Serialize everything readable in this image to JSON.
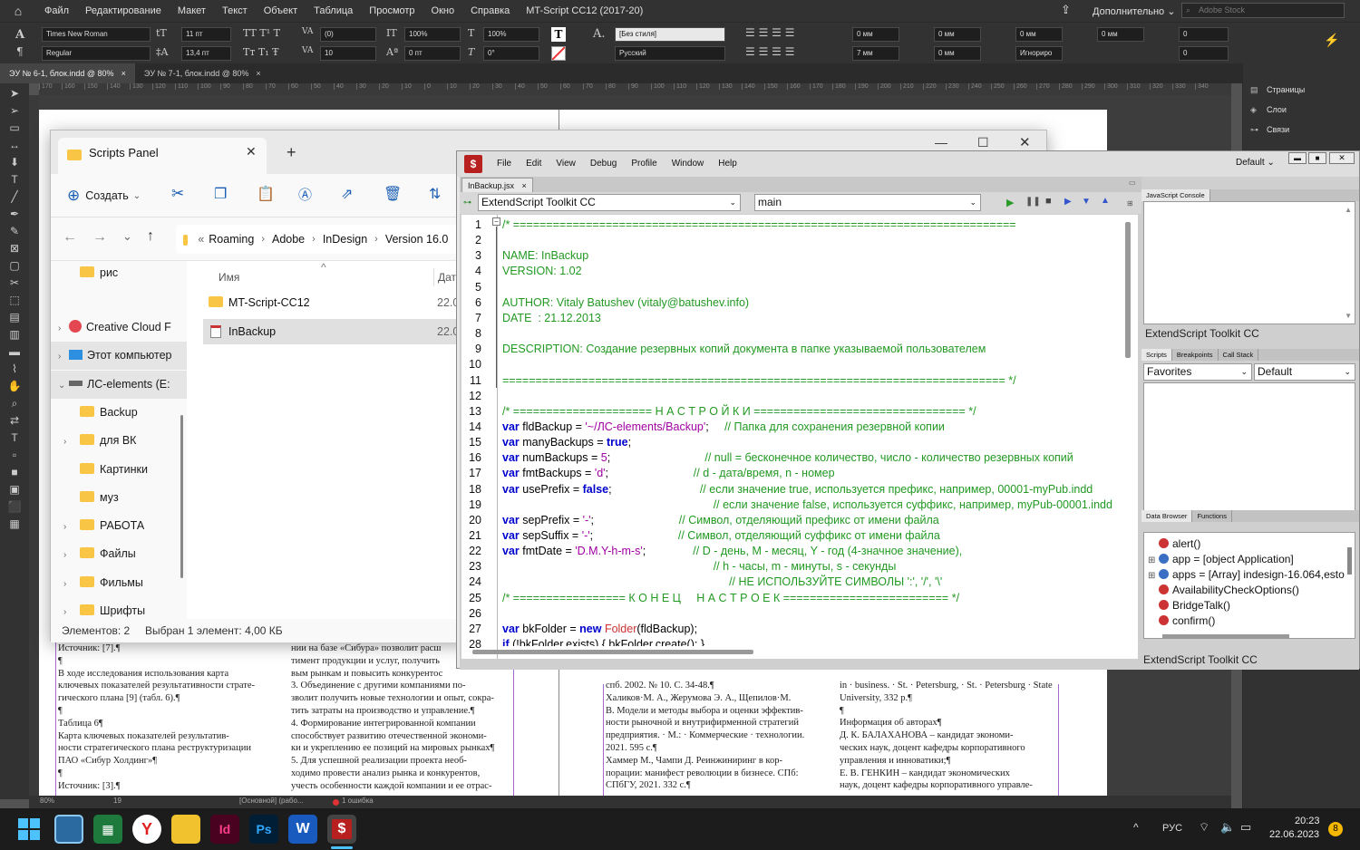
{
  "indesign": {
    "menu": [
      "Файл",
      "Редактирование",
      "Макет",
      "Текст",
      "Объект",
      "Таблица",
      "Просмотр",
      "Окно",
      "Справка",
      "MT-Script CC12 (2017-20)"
    ],
    "workspace": "Дополнительно",
    "stock_search_placeholder": "Adobe Stock",
    "control": {
      "font_family": "Times New Roman",
      "font_style": "Regular",
      "font_size": "11 пт",
      "leading": "13,4 пт",
      "kerning": "(0)",
      "tracking": "10",
      "vscale": "100%",
      "hscale": "100%",
      "baseline": "0 пт",
      "skew": "0°",
      "char_style": "[Без стиля]",
      "language": "Русский",
      "indent_left": "0 мм",
      "indent_first": "7 мм",
      "indent_right": "0 мм",
      "indent_last": "0 мм",
      "space_before": "0 мм",
      "space_after": "0 мм",
      "hyphenate": "Игнориро",
      "drop_lines": "0",
      "drop_chars": "0",
      "zero": "0"
    },
    "tabs": [
      {
        "label": "ЭУ № 6-1, блок.indd @ 80%",
        "active": true
      },
      {
        "label": "ЭУ № 7-1, блок.indd @ 80%",
        "active": false
      }
    ],
    "ruler_marks": [
      "170",
      "160",
      "150",
      "140",
      "130",
      "120",
      "110",
      "100",
      "90",
      "80",
      "70",
      "60",
      "50",
      "40",
      "30",
      "20",
      "10",
      "0",
      "10",
      "20",
      "30",
      "40",
      "50",
      "60",
      "70",
      "80",
      "90",
      "100",
      "110",
      "120",
      "130",
      "140",
      "150",
      "160",
      "170",
      "180",
      "190",
      "200",
      "210",
      "220",
      "230",
      "240",
      "250",
      "260",
      "270",
      "280",
      "290",
      "300",
      "310",
      "320",
      "330",
      "340"
    ],
    "right_panel": [
      {
        "icon": "pages-icon",
        "label": "Страницы"
      },
      {
        "icon": "layers-icon",
        "label": "Слои"
      },
      {
        "icon": "links-icon",
        "label": "Связи"
      }
    ],
    "status": {
      "zoom": "80%",
      "page": "19",
      "style": "[Основной] (рабо...",
      "errors": "1 ошибка"
    },
    "doc_col1": [
      "Источник: [7].¶",
      "¶",
      "В ходе исследования использования карта",
      "ключевых показателей результативности страте-",
      "гического плана [9] (табл. 6).¶",
      "¶",
      "Таблица 6¶",
      "Карта ключевых показателей результатив-",
      "ности стратегического плана реструктуризации",
      "ПАО «Сибур Холдинг»¶",
      "¶",
      "Источник: [3].¶"
    ],
    "doc_col2": [
      "нии на базе «Сибура» позволит расш",
      "тимент продукции и услуг, получить",
      "вым рынкам и повысить конкурентос",
      "3. Объединение с другими компаниями по-",
      "зволит получить новые технологии и опыт, сокра-",
      "тить затраты на производство и управление.¶",
      "4. Формирование интегрированной компании",
      "способствует развитию отечественной экономи-",
      "ки и укреплению ее позиций на мировых рынках¶",
      "5. Для успешной реализации проекта необ-",
      "ходимо провести анализ рынка и конкурентов,",
      "учесть особенности каждой компании и ее отрас-"
    ],
    "doc_col3": [
      "спб. 2002. № 10. С. 34-48.¶",
      "Халиков·М. А., Жерумова Э. А., Щепилов·М.",
      "В. Модели и методы выбора и оценки эффектив-",
      "ности рыночной и внутрифирменной стратегий",
      "предприятия. · М.: · Коммерческие · технологии.",
      "2021. 595 с.¶",
      "Хаммер М., Чампи Д. Реинжиниринг в кор-",
      "порации: манифест революции в бизнесе. СПб:",
      "СПбГУ, 2021. 332 с.¶"
    ],
    "doc_col4": [
      "in · business. · St. · Petersburg, · St. · Petersburg · State",
      "University, 332 p.¶",
      "¶",
      "Информация об авторах¶",
      "Д. К. БАЛАХАНОВА – кандидат экономи-",
      "ческих наук, доцент кафедры корпоративного",
      "управления и инноватики;¶",
      "Е. В. ГЕНКИН – кандидат экономических",
      "наук, доцент кафедры корпоративного управле-"
    ]
  },
  "explorer": {
    "tab_title": "Scripts Panel",
    "new_label": "Создать",
    "breadcrumb": [
      "Roaming",
      "Adobe",
      "InDesign",
      "Version 16.0"
    ],
    "nav": [
      {
        "label": "рис",
        "chev": "",
        "indent": 1,
        "kind": "folder"
      },
      {
        "label": "Creative Cloud F",
        "chev": "›",
        "indent": 0,
        "kind": "cc"
      },
      {
        "label": "Этот компьютер",
        "chev": "›",
        "indent": 0,
        "kind": "pc"
      },
      {
        "label": "ЛС-elements (E:",
        "chev": "⌄",
        "indent": 0,
        "kind": "drive"
      },
      {
        "label": "Backup",
        "chev": "",
        "indent": 1,
        "kind": "folder"
      },
      {
        "label": "для ВК",
        "chev": "›",
        "indent": 1,
        "kind": "folder"
      },
      {
        "label": "Картинки",
        "chev": "",
        "indent": 1,
        "kind": "folder"
      },
      {
        "label": "муз",
        "chev": "",
        "indent": 1,
        "kind": "folder"
      },
      {
        "label": "РАБОТА",
        "chev": "›",
        "indent": 1,
        "kind": "folder"
      },
      {
        "label": "Файлы",
        "chev": "›",
        "indent": 1,
        "kind": "folder"
      },
      {
        "label": "Фильмы",
        "chev": "›",
        "indent": 1,
        "kind": "folder"
      },
      {
        "label": "Шрифты",
        "chev": "›",
        "indent": 1,
        "kind": "folder"
      }
    ],
    "col_name": "Имя",
    "col_date": "Дата",
    "files": [
      {
        "name": "MT-Script-CC12",
        "date": "22.0",
        "kind": "folder"
      },
      {
        "name": "InBackup",
        "date": "22.0",
        "kind": "script",
        "selected": true
      }
    ],
    "status_count": "Элементов: 2",
    "status_sel": "Выбран 1 элемент: 4,00 КБ"
  },
  "estk": {
    "menu": [
      "File",
      "Edit",
      "View",
      "Debug",
      "Profile",
      "Window",
      "Help"
    ],
    "workspace": "Default",
    "doc_tab": "InBackup.jsx",
    "target": "ExtendScript Toolkit CC",
    "engine": "main",
    "lines": [
      [
        [
          "c",
          "/* ============================================================================"
        ]
      ],
      [],
      [
        [
          "c",
          "NAME: InBackup"
        ]
      ],
      [
        [
          "c",
          "VERSION: 1.02"
        ]
      ],
      [],
      [
        [
          "c",
          "AUTHOR: Vitaly Batushev (vitaly@batushev.info)"
        ]
      ],
      [
        [
          "c",
          "DATE  : 21.12.2013"
        ]
      ],
      [],
      [
        [
          "c",
          "DESCRIPTION: Создание резервных копий документа в папке указываемой пользователем"
        ]
      ],
      [],
      [
        [
          "c",
          "============================================================================ */"
        ]
      ],
      [],
      [
        [
          "c",
          "/* ===================== Н А С Т Р О Й К И ================================ */"
        ]
      ],
      [
        [
          "k",
          "var"
        ],
        [
          "n",
          " fldBackup = "
        ],
        [
          "s",
          "'~/ЛС-elements/Backup'"
        ],
        [
          "n",
          ";     "
        ],
        [
          "c",
          "// Папка для сохранения резервной копии"
        ]
      ],
      [
        [
          "k",
          "var"
        ],
        [
          "n",
          " manyBackups = "
        ],
        [
          "k",
          "true"
        ],
        [
          "n",
          ";"
        ]
      ],
      [
        [
          "k",
          "var"
        ],
        [
          "n",
          " numBackups = "
        ],
        [
          "s",
          "5"
        ],
        [
          "n",
          ";                              "
        ],
        [
          "c",
          "// null = бесконечное количество, число - количество резервных копий"
        ]
      ],
      [
        [
          "k",
          "var"
        ],
        [
          "n",
          " fmtBackups = "
        ],
        [
          "s",
          "'d'"
        ],
        [
          "n",
          ";                           "
        ],
        [
          "c",
          "// d - дата/время, n - номер"
        ]
      ],
      [
        [
          "k",
          "var"
        ],
        [
          "n",
          " usePrefix = "
        ],
        [
          "k",
          "false"
        ],
        [
          "n",
          ";                            "
        ],
        [
          "c",
          "// если значение true, используется префикс, например, 00001-myPub.indd"
        ]
      ],
      [
        [
          "n",
          "                                                                   "
        ],
        [
          "c",
          "// если значение false, используется суффикс, например, myPub-00001.indd"
        ]
      ],
      [
        [
          "k",
          "var"
        ],
        [
          "n",
          " sepPrefix = "
        ],
        [
          "s",
          "'-'"
        ],
        [
          "n",
          ";                           "
        ],
        [
          "c",
          "// Символ, отделяющий префикс от имени файла"
        ]
      ],
      [
        [
          "k",
          "var"
        ],
        [
          "n",
          " sepSuffix = "
        ],
        [
          "s",
          "'-'"
        ],
        [
          "n",
          ";                           "
        ],
        [
          "c",
          "// Символ, отделяющий суффикс от имени файла"
        ]
      ],
      [
        [
          "k",
          "var"
        ],
        [
          "n",
          " fmtDate = "
        ],
        [
          "s",
          "'D.M.Y-h-m-s'"
        ],
        [
          "n",
          ";               "
        ],
        [
          "c",
          "// D - день, M - месяц, Y - год (4-значное значение),"
        ]
      ],
      [
        [
          "n",
          "                                                                   "
        ],
        [
          "c",
          "// h - часы, m - минуты, s - секунды"
        ]
      ],
      [
        [
          "n",
          "                                                                        "
        ],
        [
          "c",
          "// НЕ ИСПОЛЬЗУЙТЕ СИМВОЛЫ ':', '/', '\\'"
        ]
      ],
      [
        [
          "c",
          "/* ================= К О Н Е Ц     Н А С Т Р О Е К ========================= */"
        ]
      ],
      [],
      [
        [
          "k",
          "var"
        ],
        [
          "n",
          " bkFolder = "
        ],
        [
          "k",
          "new"
        ],
        [
          "n",
          " "
        ],
        [
          "x",
          "Folder"
        ],
        [
          "n",
          "(fldBackup);"
        ]
      ],
      [
        [
          "k",
          "if"
        ],
        [
          "n",
          " (!bkFolder.exists) { bkFolder.create(); }"
        ]
      ]
    ],
    "console_tab": "JavaScript Console",
    "console_footer": "ExtendScript Toolkit CC",
    "scripts_tabs": [
      "Scripts",
      "Breakpoints",
      "Call Stack"
    ],
    "scripts_sel1": "Favorites",
    "scripts_sel2": "Default",
    "data_tabs": [
      "Data Browser",
      "Functions"
    ],
    "data_rows": [
      {
        "text": "alert()",
        "exp": "",
        "icon": "fn"
      },
      {
        "text": "app = [object Application]",
        "exp": "+",
        "icon": "obj"
      },
      {
        "text": "apps = [Array] indesign-16.064,esto",
        "exp": "+",
        "icon": "obj"
      },
      {
        "text": "AvailabilityCheckOptions()",
        "exp": "",
        "icon": "fn"
      },
      {
        "text": "BridgeTalk()",
        "exp": "",
        "icon": "fn"
      },
      {
        "text": "confirm()",
        "exp": "",
        "icon": "fn"
      }
    ],
    "data_footer": "ExtendScript Toolkit CC"
  },
  "taskbar": {
    "lang": "РУС",
    "time": "20:23",
    "date": "22.06.2023",
    "badge": "8"
  },
  "colors": {
    "id_bg": "#323232",
    "estk_comment": "#229922",
    "estk_keyword": "#0000cc",
    "estk_string": "#a000a0"
  }
}
